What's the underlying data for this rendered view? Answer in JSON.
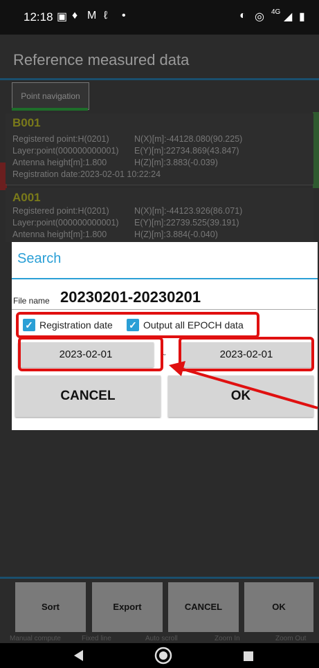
{
  "status_bar": {
    "time": "12:18",
    "network": "4G"
  },
  "app": {
    "title": "Reference measured data",
    "tab": "Point navigation",
    "points": [
      {
        "id": "B001",
        "registered_point": "Registered point:H(0201)",
        "layer": "Layer:point(000000000001)",
        "antenna": "Antenna height[m]:1.800",
        "date": "Registration date:2023-02-01 10:22:24",
        "nx": "N(X)[m]:-44128.080(90.225)",
        "ey": "E(Y)[m]:22734.869(43.847)",
        "hz": "H(Z)[m]:3.883(-0.039)"
      },
      {
        "id": "A001",
        "registered_point": "Registered point:H(0201)",
        "layer": "Layer:point(000000000001)",
        "antenna": "Antenna height[m]:1.800",
        "nx": "N(X)[m]:-44123.926(86.071)",
        "ey": "E(Y)[m]:22739.525(39.191)",
        "hz": "H(Z)[m]:3.884(-0.040)"
      }
    ],
    "bottom_buttons": [
      "Sort",
      "Export",
      "CANCEL",
      "OK"
    ],
    "sub_labels": [
      "Manual compute",
      "Fixed line",
      "Auto scroll",
      "Zoom In",
      "Zoom Out"
    ]
  },
  "dialog": {
    "title": "Search",
    "file_name_label": "File name",
    "file_name_value": "20230201-20230201",
    "checkbox_registration": "Registration date",
    "checkbox_epoch": "Output all EPOCH data",
    "date_from": "2023-02-01",
    "date_sep": "~",
    "date_to": "2023-02-01",
    "cancel": "CANCEL",
    "ok": "OK"
  },
  "colors": {
    "accent": "#2a9fd6",
    "highlight": "#e01010"
  }
}
